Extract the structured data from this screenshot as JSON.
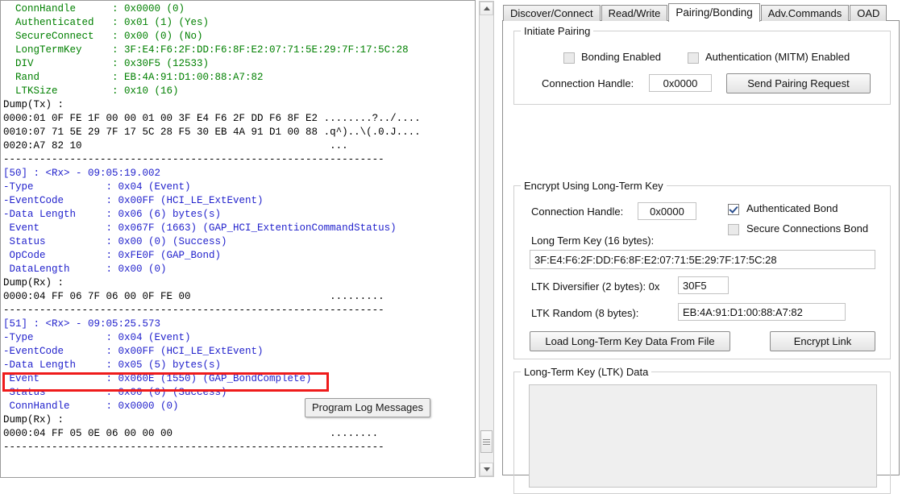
{
  "log": {
    "lines": [
      {
        "t": "  ConnHandle      : 0x0000 (0)",
        "c": "lg"
      },
      {
        "t": "  Authenticated   : 0x01 (1) (Yes)",
        "c": "lg"
      },
      {
        "t": "  SecureConnect   : 0x00 (0) (No)",
        "c": "lg"
      },
      {
        "t": "  LongTermKey     : 3F:E4:F6:2F:DD:F6:8F:E2:07:71:5E:29:7F:17:5C:28",
        "c": "lg"
      },
      {
        "t": "  DIV             : 0x30F5 (12533)",
        "c": "lg"
      },
      {
        "t": "  Rand            : EB:4A:91:D1:00:88:A7:82",
        "c": "lg"
      },
      {
        "t": "  LTKSize         : 0x10 (16)",
        "c": "lg"
      },
      {
        "t": "Dump(Tx) :",
        "c": "bk"
      },
      {
        "t": "0000:01 0F FE 1F 00 00 01 00 3F E4 F6 2F DD F6 8F E2 ........?../....",
        "c": "bk"
      },
      {
        "t": "0010:07 71 5E 29 7F 17 5C 28 F5 30 EB 4A 91 D1 00 88 .q^)..\\(.0.J....",
        "c": "bk"
      },
      {
        "t": "0020:A7 82 10                                         ...",
        "c": "bk"
      },
      {
        "t": "---------------------------------------------------------------",
        "c": "bk"
      },
      {
        "t": "[50] : <Rx> - 09:05:19.002",
        "c": "bl"
      },
      {
        "t": "-Type            : 0x04 (Event)",
        "c": "bl"
      },
      {
        "t": "-EventCode       : 0x00FF (HCI_LE_ExtEvent)",
        "c": "bl"
      },
      {
        "t": "-Data Length     : 0x06 (6) bytes(s)",
        "c": "bl"
      },
      {
        "t": " Event           : 0x067F (1663) (GAP_HCI_ExtentionCommandStatus)",
        "c": "bl"
      },
      {
        "t": " Status          : 0x00 (0) (Success)",
        "c": "bl"
      },
      {
        "t": " OpCode          : 0xFE0F (GAP_Bond)",
        "c": "bl"
      },
      {
        "t": " DataLength      : 0x00 (0)",
        "c": "bl"
      },
      {
        "t": "Dump(Rx) :",
        "c": "bk"
      },
      {
        "t": "0000:04 FF 06 7F 06 00 0F FE 00                       .........",
        "c": "bk"
      },
      {
        "t": "---------------------------------------------------------------",
        "c": "bk"
      },
      {
        "t": "[51] : <Rx> - 09:05:25.573",
        "c": "bl"
      },
      {
        "t": "-Type            : 0x04 (Event)",
        "c": "bl"
      },
      {
        "t": "-EventCode       : 0x00FF (HCI_LE_ExtEvent)",
        "c": "bl"
      },
      {
        "t": "-Data Length     : 0x05 (5) bytes(s)",
        "c": "bl"
      },
      {
        "t": " Event           : 0x060E (1550) (GAP_BondComplete)",
        "c": "bl"
      },
      {
        "t": " Status          : 0x00 (0) (Success)",
        "c": "bl"
      },
      {
        "t": " ConnHandle      : 0x0000 (0)",
        "c": "bl"
      },
      {
        "t": "Dump(Rx) :",
        "c": "bk"
      },
      {
        "t": "0000:04 FF 05 0E 06 00 00 00                          ........",
        "c": "bk"
      },
      {
        "t": "---------------------------------------------------------------",
        "c": "bk"
      }
    ],
    "tooltip": "Program Log Messages",
    "highlight_color": "#ef1b1b",
    "color_green": "#008000",
    "color_blue": "#2222cc"
  },
  "tabs": [
    {
      "label": "Discover/Connect",
      "active": false
    },
    {
      "label": "Read/Write",
      "active": false
    },
    {
      "label": "Pairing/Bonding",
      "active": true
    },
    {
      "label": "Adv.Commands",
      "active": false
    },
    {
      "label": "OAD",
      "active": false
    }
  ],
  "pairing": {
    "title": "Initiate Pairing",
    "bonding_enabled_label": "Bonding Enabled",
    "bonding_enabled_checked": false,
    "mitm_label": "Authentication (MITM) Enabled",
    "mitm_checked": false,
    "conn_handle_label": "Connection Handle:",
    "conn_handle_value": "0x0000",
    "send_button": "Send Pairing Request"
  },
  "encrypt": {
    "title": "Encrypt Using Long-Term Key",
    "conn_handle_label": "Connection Handle:",
    "conn_handle_value": "0x0000",
    "auth_bond_label": "Authenticated Bond",
    "auth_bond_checked": true,
    "sc_bond_label": "Secure Connections Bond",
    "sc_bond_checked": false,
    "ltk_label": "Long Term Key (16 bytes):",
    "ltk_value": "3F:E4:F6:2F:DD:F6:8F:E2:07:71:5E:29:7F:17:5C:28",
    "div_label": "LTK Diversifier (2 bytes): 0x",
    "div_value": "30F5",
    "rand_label": "LTK Random (8 bytes):",
    "rand_value": "EB:4A:91:D1:00:88:A7:82",
    "load_button": "Load Long-Term Key Data From File",
    "encrypt_button": "Encrypt Link"
  },
  "ltk_data": {
    "title": "Long-Term Key (LTK) Data",
    "content": ""
  }
}
